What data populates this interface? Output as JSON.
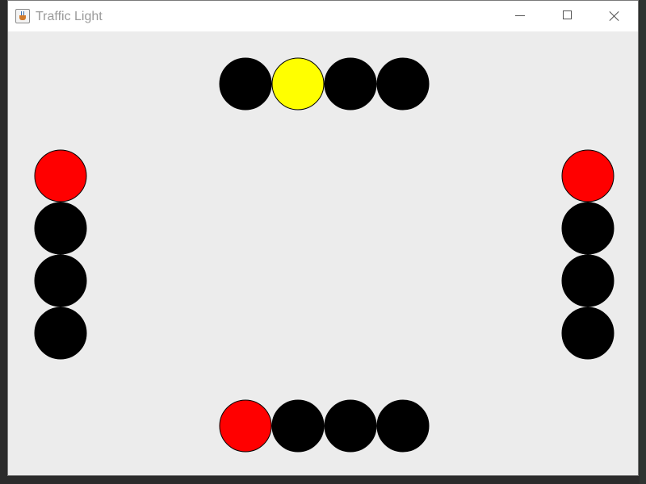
{
  "window": {
    "title": "Traffic Light",
    "app_icon": "java-cup-icon",
    "controls": [
      "minimize-icon",
      "maximize-icon",
      "close-icon"
    ]
  },
  "colors": {
    "red": "#ff0000",
    "yellow": "#ffff00",
    "off": "#000000",
    "background": "#ececec"
  },
  "traffic_lights": [
    {
      "name": "north",
      "orientation": "horizontal",
      "lamps": [
        "off",
        "yellow",
        "off",
        "off"
      ]
    },
    {
      "name": "west",
      "orientation": "vertical",
      "lamps": [
        "red",
        "off",
        "off",
        "off"
      ]
    },
    {
      "name": "east",
      "orientation": "vertical",
      "lamps": [
        "red",
        "off",
        "off",
        "off"
      ]
    },
    {
      "name": "south",
      "orientation": "horizontal",
      "lamps": [
        "red",
        "off",
        "off",
        "off"
      ]
    }
  ]
}
